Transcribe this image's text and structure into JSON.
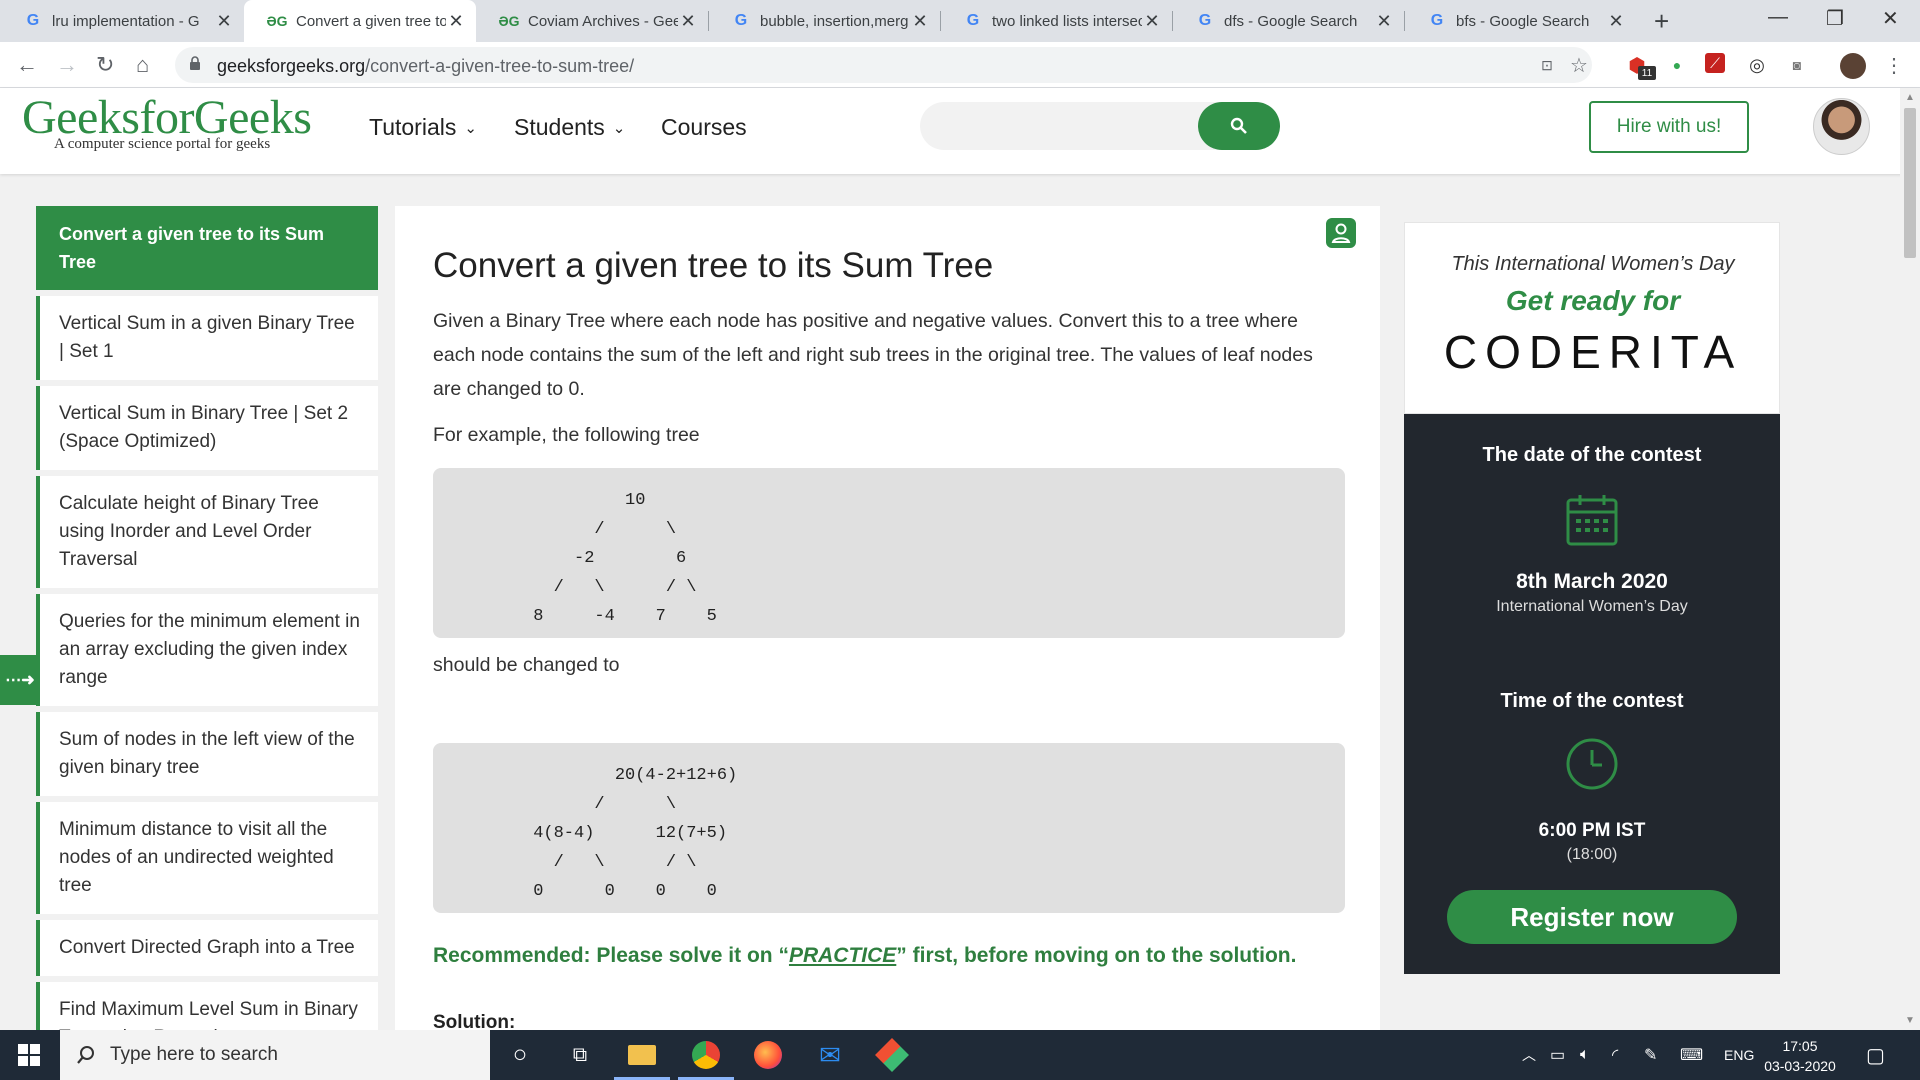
{
  "browser": {
    "tabs": [
      {
        "title": "lru implementation - G",
        "favicon": "google-icon",
        "active": false
      },
      {
        "title": "Convert a given tree to",
        "favicon": "gfg-icon",
        "active": true
      },
      {
        "title": "Coviam Archives - Gee",
        "favicon": "gfg-icon",
        "active": false
      },
      {
        "title": "bubble, insertion,merg",
        "favicon": "google-icon",
        "active": false
      },
      {
        "title": "two linked lists intersec",
        "favicon": "google-icon",
        "active": false
      },
      {
        "title": "dfs - Google Search",
        "favicon": "google-icon",
        "active": false
      },
      {
        "title": "bfs - Google Search",
        "favicon": "google-icon",
        "active": false
      }
    ],
    "url_host": "geeksforgeeks.org",
    "url_path": "/convert-a-given-tree-to-sum-tree/",
    "ext_badge": "11"
  },
  "header": {
    "logo": "GeeksforGeeks",
    "tagline": "A computer science portal for geeks",
    "nav": [
      "Tutorials",
      "Students",
      "Courses"
    ],
    "search_placeholder": "",
    "hire_label": "Hire with us!"
  },
  "sidebar": {
    "items": [
      {
        "label": "Convert a given tree to its Sum Tree",
        "active": true
      },
      {
        "label": "Vertical Sum in a given Binary Tree | Set 1"
      },
      {
        "label": "Vertical Sum in Binary Tree | Set 2 (Space Optimized)"
      },
      {
        "label": "Calculate height of Binary Tree using Inorder and Level Order Traversal"
      },
      {
        "label": "Queries for the minimum element in an array excluding the given index range"
      },
      {
        "label": "Sum of nodes in the left view of the given binary tree"
      },
      {
        "label": "Minimum distance to visit all the nodes of an undirected weighted tree"
      },
      {
        "label": "Convert Directed Graph into a Tree"
      },
      {
        "label": "Find Maximum Level Sum in Binary Tree using Recursion"
      }
    ]
  },
  "article": {
    "title": "Convert a given tree to its Sum Tree",
    "intro": "Given a Binary Tree where each node has positive and negative values. Convert this to a tree where each node contains the sum of the left and right sub trees in the original tree. The values of leaf nodes are changed to 0.",
    "example_label": "For example, the following tree",
    "code1": "          10\n       /      \\\n     -2        6\n   /   \\      / \\\n 8     -4    7    5",
    "changed_label": "should be changed to",
    "code2": "         20(4-2+12+6)\n       /      \\\n 4(8-4)      12(7+5)\n   /   \\      / \\\n 0      0    0    0",
    "recommend_prefix": "Recommended: Please solve it on “",
    "recommend_link": "PRACTICE",
    "recommend_suffix": "” first, before moving on to the solution.",
    "solution_heading": "Solution:"
  },
  "ad": {
    "line1": "This International Women’s Day",
    "line2": "Get ready for",
    "brand": "CODERITA",
    "date_heading": "The date of the contest",
    "date_value": "8th March 2020",
    "date_sub": "International Women’s Day",
    "time_heading": "Time of the contest",
    "time_value": "6:00 PM IST",
    "time_sub": "(18:00)",
    "register_label": "Register now"
  },
  "taskbar": {
    "search_placeholder": "Type here to search",
    "lang": "ENG",
    "time": "17:05",
    "date": "03-03-2020"
  },
  "colors": {
    "gfg_green": "#2f8d46",
    "ad_dark": "#22272e",
    "taskbar": "#1f2a37"
  }
}
